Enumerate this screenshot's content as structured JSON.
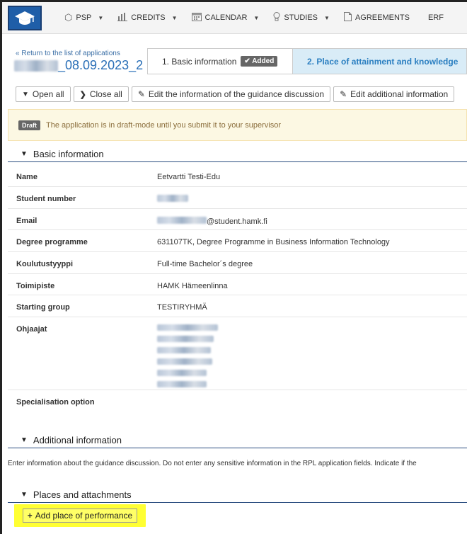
{
  "nav": {
    "items": [
      {
        "label": "PSP",
        "icon": "shield-icon"
      },
      {
        "label": "CREDITS",
        "icon": "bar-chart-icon"
      },
      {
        "label": "CALENDAR",
        "icon": "calendar-icon"
      },
      {
        "label": "STUDIES",
        "icon": "lightbulb-icon"
      },
      {
        "label": "AGREEMENTS",
        "icon": "document-icon"
      },
      {
        "label": "ERF",
        "icon": ""
      }
    ]
  },
  "header": {
    "back_link": "« Return to the list of applications",
    "app_id_suffix": "_08.09.2023_2",
    "step1_label": "1. Basic information",
    "step1_badge": "Added",
    "step2_label": "2. Place of attainment and knowledge"
  },
  "toolbar": {
    "open_all": "Open all",
    "close_all": "Close all",
    "edit_guidance": "Edit the information of the guidance discussion",
    "edit_additional": "Edit additional information"
  },
  "draft": {
    "tag": "Draft",
    "text": "The application is in draft-mode until you submit it to your supervisor"
  },
  "basic_info": {
    "title": "Basic information",
    "rows": {
      "name": {
        "label": "Name",
        "value": "Eetvartti Testi-Edu"
      },
      "student_number": {
        "label": "Student number",
        "value": ""
      },
      "email": {
        "label": "Email",
        "value": "@student.hamk.fi"
      },
      "degree": {
        "label": "Degree programme",
        "value": "631107TK, Degree Programme in Business Information Technology"
      },
      "edu_type": {
        "label": "Koulutustyyppi",
        "value": "Full-time Bachelor´s degree"
      },
      "office": {
        "label": "Toimipiste",
        "value": "HAMK Hämeenlinna"
      },
      "group": {
        "label": "Starting group",
        "value": "TESTIRYHMÄ"
      },
      "supervisors": {
        "label": "Ohjaajat"
      },
      "specialisation": {
        "label": "Specialisation option",
        "value": ""
      }
    }
  },
  "additional": {
    "title": "Additional information",
    "hint": "Enter information about the guidance discussion. Do not enter any sensitive information in the RPL application fields. Indicate if the"
  },
  "places": {
    "title": "Places and attachments",
    "add_label": "Add place of performance"
  }
}
